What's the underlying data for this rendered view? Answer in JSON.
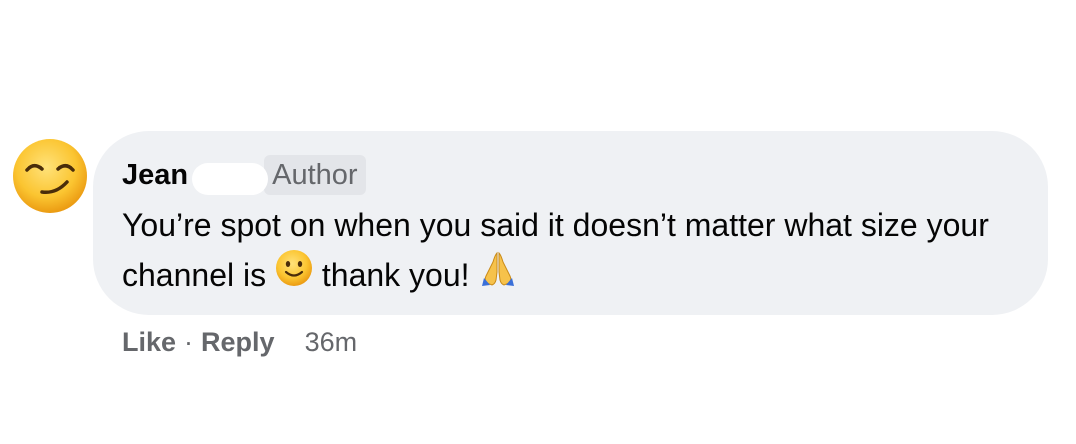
{
  "comment": {
    "author": "Jean",
    "badge": "Author",
    "avatar_emoji": "smirking-face",
    "text_part1": "You’re spot on when you said it doesn’t matter what size your channel is",
    "text_part2": "thank you!",
    "inline_emojis": [
      "slightly-smiling-face",
      "folded-hands"
    ]
  },
  "actions": {
    "like_label": "Like",
    "separator": "·",
    "reply_label": "Reply",
    "timestamp": "36m"
  },
  "colors": {
    "bubble_bg": "#eff1f4",
    "badge_bg": "#e3e5e9",
    "secondary_text": "#65676b",
    "primary_text": "#050505"
  }
}
